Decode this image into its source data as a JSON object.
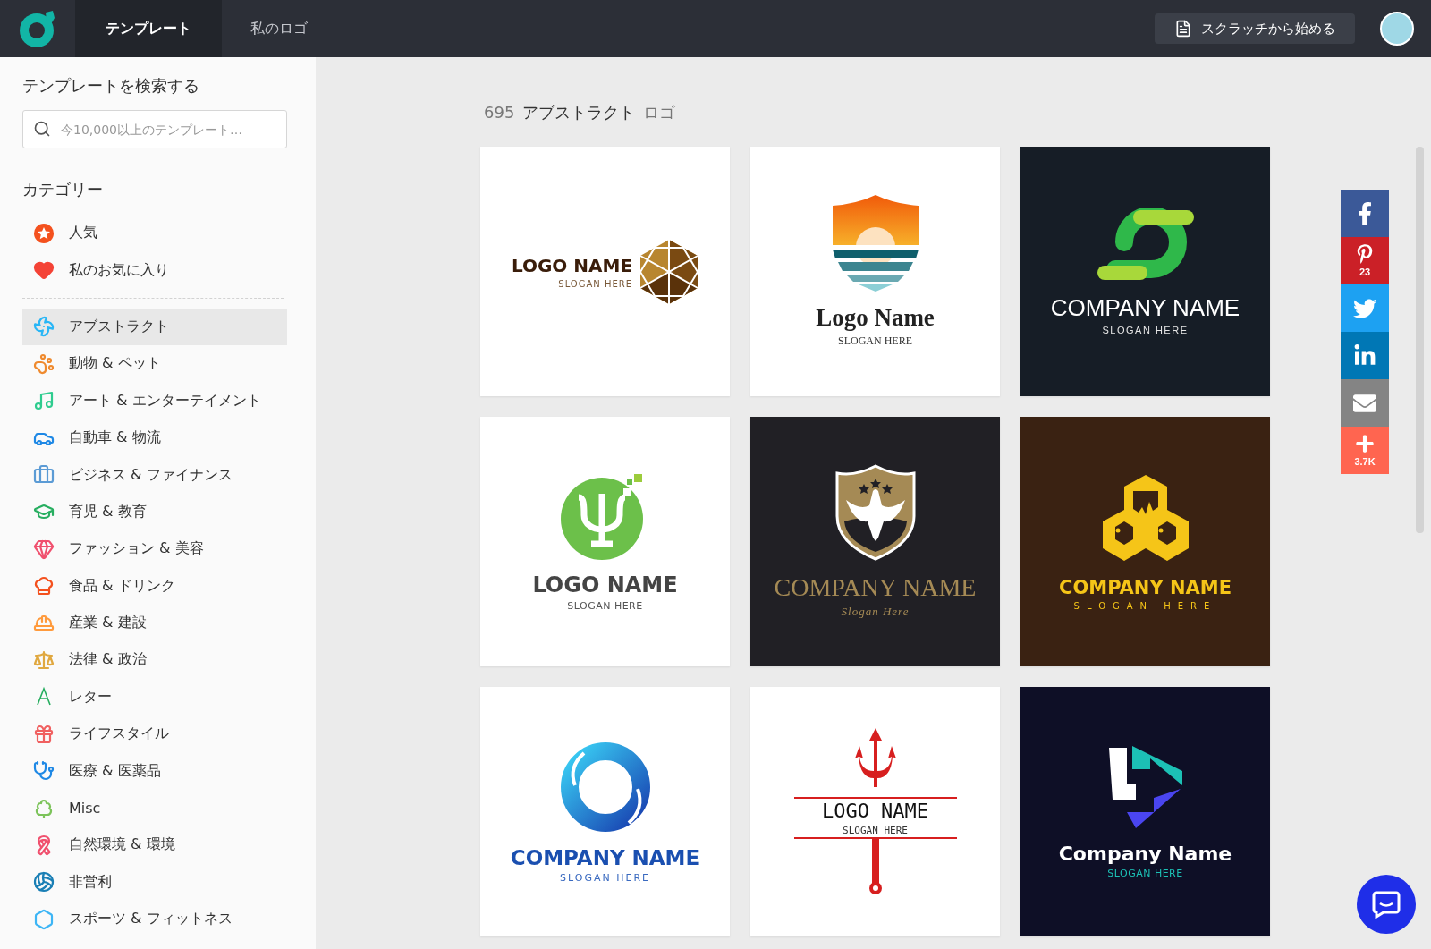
{
  "topbar": {
    "tabs": [
      {
        "label": "テンプレート",
        "selected": true
      },
      {
        "label": "私のロゴ",
        "selected": false
      }
    ],
    "start_button": "スクラッチから始める"
  },
  "sidebar": {
    "search_title": "テンプレートを検索する",
    "search": {
      "placeholder": "今10,000以上のテンプレート…"
    },
    "categories_title": "カテゴリー",
    "favorites": [
      {
        "label": "人気",
        "kind": "popular",
        "color": "#f4511e"
      },
      {
        "label": "私のお気に入り",
        "kind": "favorite",
        "color": "#f44336"
      }
    ],
    "categories": [
      {
        "label": "アブストラクト",
        "kind": "abstract",
        "color": "#29b6f6",
        "selected": true
      },
      {
        "label": "動物 & ペット",
        "kind": "pets",
        "color": "#ef8a2e",
        "selected": false
      },
      {
        "label": "アート & エンターテイメント",
        "kind": "art",
        "color": "#2ecc8f",
        "selected": false
      },
      {
        "label": "自動車 & 物流",
        "kind": "car",
        "color": "#1e88e5",
        "selected": false
      },
      {
        "label": "ビジネス & ファイナンス",
        "kind": "business",
        "color": "#5b9bd5",
        "selected": false
      },
      {
        "label": "育児 & 教育",
        "kind": "education",
        "color": "#27ae60",
        "selected": false
      },
      {
        "label": "ファッション & 美容",
        "kind": "fashion",
        "color": "#f0506e",
        "selected": false
      },
      {
        "label": "食品 & ドリンク",
        "kind": "food",
        "color": "#f4511e",
        "selected": false
      },
      {
        "label": "産業 & 建設",
        "kind": "industry",
        "color": "#ff9a3c",
        "selected": false
      },
      {
        "label": "法律 & 政治",
        "kind": "law",
        "color": "#e0a840",
        "selected": false
      },
      {
        "label": "レター",
        "kind": "letter",
        "color": "#27ae60",
        "selected": false
      },
      {
        "label": "ライフスタイル",
        "kind": "lifestyle",
        "color": "#f06060",
        "selected": false
      },
      {
        "label": "医療 & 医薬品",
        "kind": "medical",
        "color": "#1e88e5",
        "selected": false
      },
      {
        "label": "Misc",
        "kind": "misc",
        "color": "#7cc35a",
        "selected": false
      },
      {
        "label": "自然環境 & 環境",
        "kind": "nature",
        "color": "#f0506e",
        "selected": false
      },
      {
        "label": "非営利",
        "kind": "nonprofit",
        "color": "#1a7fb5",
        "selected": false
      },
      {
        "label": "スポーツ & フィットネス",
        "kind": "sports",
        "color": "#3db5f5",
        "selected": false
      }
    ]
  },
  "main": {
    "count": "695",
    "category": "アブストラクト",
    "suffix": "ロゴ",
    "templates": [
      {
        "kind": "hexagon",
        "name": "LOGO NAME",
        "slogan": "SLOGAN HERE"
      },
      {
        "kind": "sunshield",
        "name": "Logo Name",
        "slogan": "SLOGAN HERE"
      },
      {
        "kind": "swirl",
        "name": "COMPANY NAME",
        "slogan": "SLOGAN HERE"
      },
      {
        "kind": "psi",
        "name": "LOGO NAME",
        "slogan": "SLOGAN HERE"
      },
      {
        "kind": "eagle",
        "name": "COMPANY NAME",
        "slogan": "Slogan Here"
      },
      {
        "kind": "honeycomb",
        "name": "COMPANY NAME",
        "slogan": "SLOGAN HERE"
      },
      {
        "kind": "ring",
        "name": "COMPANY NAME",
        "slogan": "SLOGAN HERE"
      },
      {
        "kind": "trident",
        "name": "LOGO NAME",
        "slogan": "SLOGAN HERE"
      },
      {
        "kind": "play",
        "name": "Company Name",
        "slogan": "SLOGAN HERE"
      }
    ]
  },
  "share": [
    {
      "kind": "facebook"
    },
    {
      "kind": "pinterest",
      "count": "23"
    },
    {
      "kind": "twitter"
    },
    {
      "kind": "linkedin"
    },
    {
      "kind": "email"
    },
    {
      "kind": "more",
      "count": "3.7K"
    }
  ]
}
